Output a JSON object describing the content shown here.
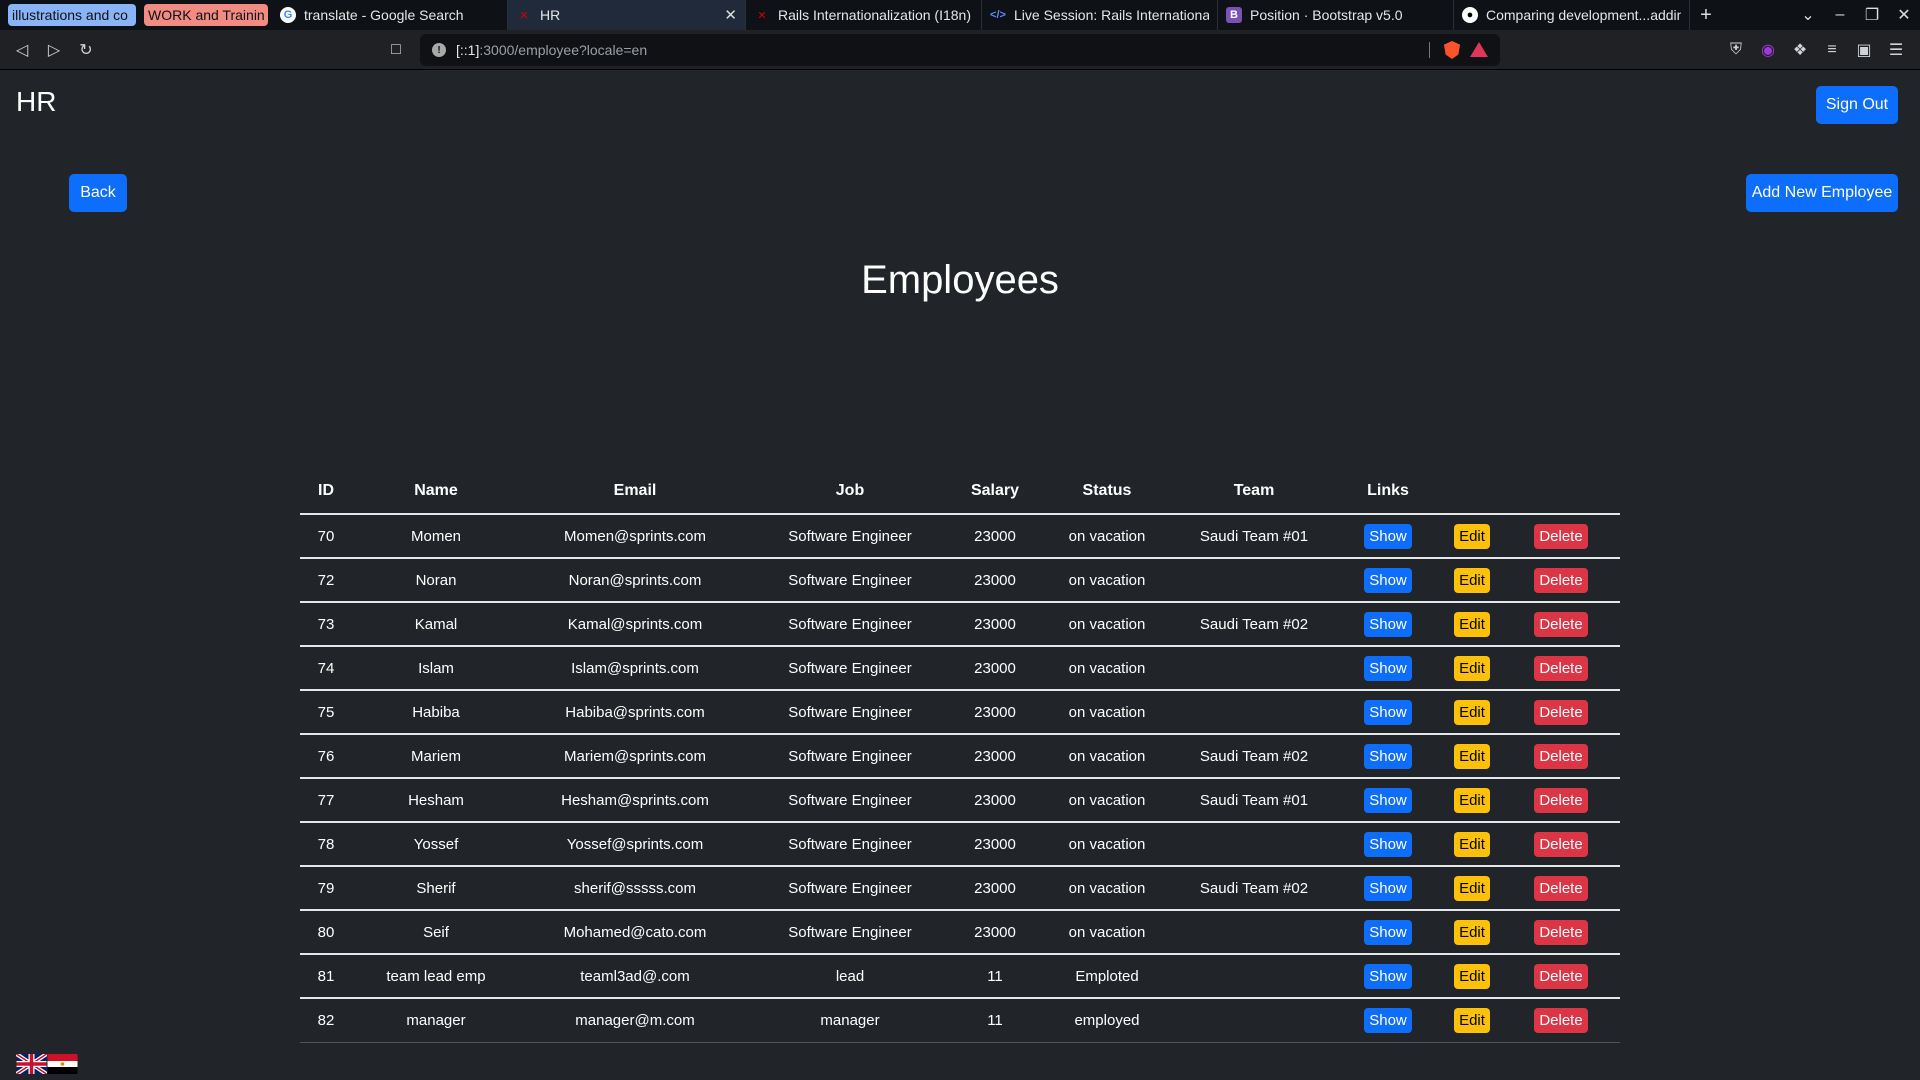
{
  "browser": {
    "tabs": [
      {
        "title": "illustrations and co",
        "group": "blue"
      },
      {
        "title": "WORK and Training",
        "group": "red"
      },
      {
        "title": "translate - Google Search",
        "icon": "google-icon"
      },
      {
        "title": "HR",
        "icon": "rails-icon",
        "active": true
      },
      {
        "title": "Rails Internationalization (I18n)",
        "icon": "rails-icon"
      },
      {
        "title": "Live Session: Rails Internationalization",
        "icon": "code-icon"
      },
      {
        "title": "Position · Bootstrap v5.0",
        "icon": "bootstrap-icon"
      },
      {
        "title": "Comparing development...adding",
        "icon": "github-icon"
      }
    ],
    "url_host": "[::1]",
    "url_rest": ":3000/employee?locale=en"
  },
  "header": {
    "brand": "HR",
    "sign_out": "Sign Out"
  },
  "actions": {
    "back": "Back",
    "add_new": "Add New Employee"
  },
  "page_title": "Employees",
  "table": {
    "columns": [
      "ID",
      "Name",
      "Email",
      "Job",
      "Salary",
      "Status",
      "Team",
      "Links"
    ],
    "link_labels": {
      "show": "Show",
      "edit": "Edit",
      "delete": "Delete"
    },
    "rows": [
      {
        "id": "70",
        "name": "Momen",
        "email": "Momen@sprints.com",
        "job": "Software Engineer",
        "salary": "23000",
        "status": "on vacation",
        "team": "Saudi Team #01"
      },
      {
        "id": "72",
        "name": "Noran",
        "email": "Noran@sprints.com",
        "job": "Software Engineer",
        "salary": "23000",
        "status": "on vacation",
        "team": ""
      },
      {
        "id": "73",
        "name": "Kamal",
        "email": "Kamal@sprints.com",
        "job": "Software Engineer",
        "salary": "23000",
        "status": "on vacation",
        "team": "Saudi Team #02"
      },
      {
        "id": "74",
        "name": "Islam",
        "email": "Islam@sprints.com",
        "job": "Software Engineer",
        "salary": "23000",
        "status": "on vacation",
        "team": ""
      },
      {
        "id": "75",
        "name": "Habiba",
        "email": "Habiba@sprints.com",
        "job": "Software Engineer",
        "salary": "23000",
        "status": "on vacation",
        "team": ""
      },
      {
        "id": "76",
        "name": "Mariem",
        "email": "Mariem@sprints.com",
        "job": "Software Engineer",
        "salary": "23000",
        "status": "on vacation",
        "team": "Saudi Team #02"
      },
      {
        "id": "77",
        "name": "Hesham",
        "email": "Hesham@sprints.com",
        "job": "Software Engineer",
        "salary": "23000",
        "status": "on vacation",
        "team": "Saudi Team #01"
      },
      {
        "id": "78",
        "name": "Yossef",
        "email": "Yossef@sprints.com",
        "job": "Software Engineer",
        "salary": "23000",
        "status": "on vacation",
        "team": ""
      },
      {
        "id": "79",
        "name": "Sherif",
        "email": "sherif@sssss.com",
        "job": "Software Engineer",
        "salary": "23000",
        "status": "on vacation",
        "team": "Saudi Team #02"
      },
      {
        "id": "80",
        "name": "Seif",
        "email": "Mohamed@cato.com",
        "job": "Software Engineer",
        "salary": "23000",
        "status": "on vacation",
        "team": ""
      },
      {
        "id": "81",
        "name": "team lead emp",
        "email": "teaml3ad@.com",
        "job": "lead",
        "salary": "11",
        "status": "Emploted",
        "team": ""
      },
      {
        "id": "82",
        "name": "manager",
        "email": "manager@m.com",
        "job": "manager",
        "salary": "11",
        "status": "employed",
        "team": ""
      }
    ]
  },
  "locale_flags": [
    "uk-flag-icon",
    "egypt-flag-icon"
  ],
  "colors": {
    "bg": "#212529",
    "primary": "#0d6efd",
    "warning": "#ffc107",
    "danger": "#dc3545"
  }
}
